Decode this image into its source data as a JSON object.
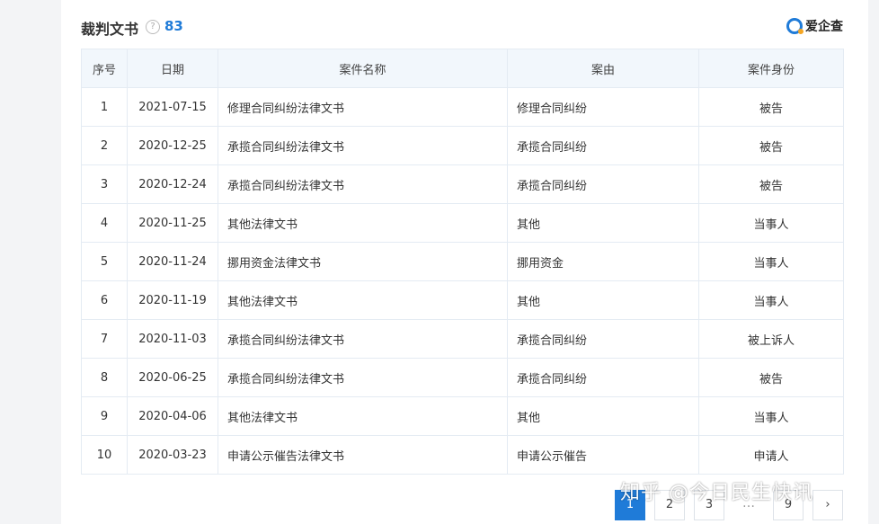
{
  "header": {
    "title": "裁判文书",
    "help_icon": "question-circle-icon",
    "count": "83",
    "brand": "爱企查",
    "brand_icon": "aiqicha-logo-icon"
  },
  "table": {
    "columns": [
      "序号",
      "日期",
      "案件名称",
      "案由",
      "案件身份"
    ],
    "rows": [
      [
        "1",
        "2021-07-15",
        "修理合同纠纷法律文书",
        "修理合同纠纷",
        "被告"
      ],
      [
        "2",
        "2020-12-25",
        "承揽合同纠纷法律文书",
        "承揽合同纠纷",
        "被告"
      ],
      [
        "3",
        "2020-12-24",
        "承揽合同纠纷法律文书",
        "承揽合同纠纷",
        "被告"
      ],
      [
        "4",
        "2020-11-25",
        "其他法律文书",
        "其他",
        "当事人"
      ],
      [
        "5",
        "2020-11-24",
        "挪用资金法律文书",
        "挪用资金",
        "当事人"
      ],
      [
        "6",
        "2020-11-19",
        "其他法律文书",
        "其他",
        "当事人"
      ],
      [
        "7",
        "2020-11-03",
        "承揽合同纠纷法律文书",
        "承揽合同纠纷",
        "被上诉人"
      ],
      [
        "8",
        "2020-06-25",
        "承揽合同纠纷法律文书",
        "承揽合同纠纷",
        "被告"
      ],
      [
        "9",
        "2020-04-06",
        "其他法律文书",
        "其他",
        "当事人"
      ],
      [
        "10",
        "2020-03-23",
        "申请公示催告法律文书",
        "申请公示催告",
        "申请人"
      ]
    ]
  },
  "pagination": {
    "pages": [
      "1",
      "2",
      "3"
    ],
    "ellipsis": "…",
    "last": "9",
    "next": "›",
    "current": "1"
  },
  "watermark": "知乎 @今日民生快讯",
  "colors": {
    "accent": "#1f7bd8",
    "header_bg": "#f2f7fc",
    "border": "#e4ebf3"
  }
}
